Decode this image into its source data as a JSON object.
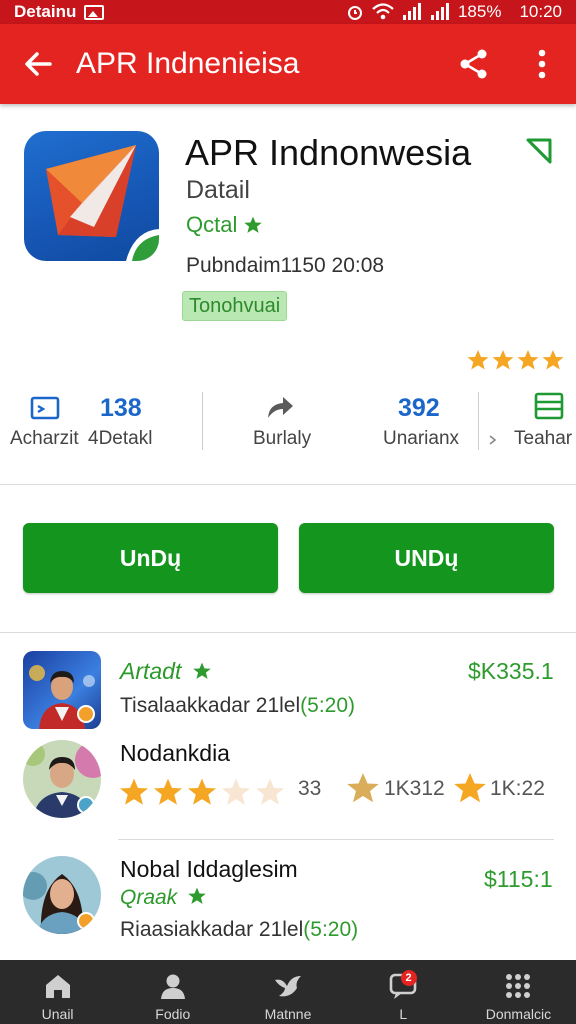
{
  "status_bar": {
    "carrier": "Detainu",
    "battery": "185%",
    "time": "10:20"
  },
  "app_bar": {
    "title": "APR Indnenieisa"
  },
  "app": {
    "name": "APR Indnonwesia",
    "subtitle": "Datail",
    "rating_label": "Qctal",
    "published": "Pubndaim1150 20:08",
    "badge": "Tonohvuai"
  },
  "stats": [
    {
      "label": "Acharzit",
      "value": ""
    },
    {
      "label": "4Detakl",
      "value": "138"
    },
    {
      "label": "Burlaly",
      "value": ""
    },
    {
      "label": "Unarianx",
      "value": "392"
    },
    {
      "label": "Teahar",
      "value": ""
    }
  ],
  "buttons": {
    "left": "UnDų",
    "right": "UNDų"
  },
  "reviews": [
    {
      "name": "Artadt",
      "price": "$K335.1",
      "meta_text": "Tisalaakkadar 21lel",
      "meta_time": "(5:20)"
    },
    {
      "name": "Nodankdia",
      "count1": "33",
      "count2": "1K312",
      "count3": "1K:22"
    },
    {
      "name": "Nobal Iddaglesim",
      "rating_label": "Qraak",
      "price": "$115:1",
      "meta_text": "Riaasiakkadar 21lel",
      "meta_time": "(5:20)"
    }
  ],
  "bottom_nav": [
    {
      "label": "Unail",
      "icon": "home-icon"
    },
    {
      "label": "Fodio",
      "icon": "person-icon"
    },
    {
      "label": "Matnne",
      "icon": "bird-icon"
    },
    {
      "label": "L",
      "icon": "chat-icon",
      "badge": "2"
    },
    {
      "label": "Donmalcic",
      "icon": "grid-icon"
    }
  ],
  "colors": {
    "app_bar": "#e32420",
    "status_bar": "#c6161b",
    "accent_blue": "#1b66c9",
    "install_green": "#14961e",
    "star_gold": "#f5a623"
  }
}
